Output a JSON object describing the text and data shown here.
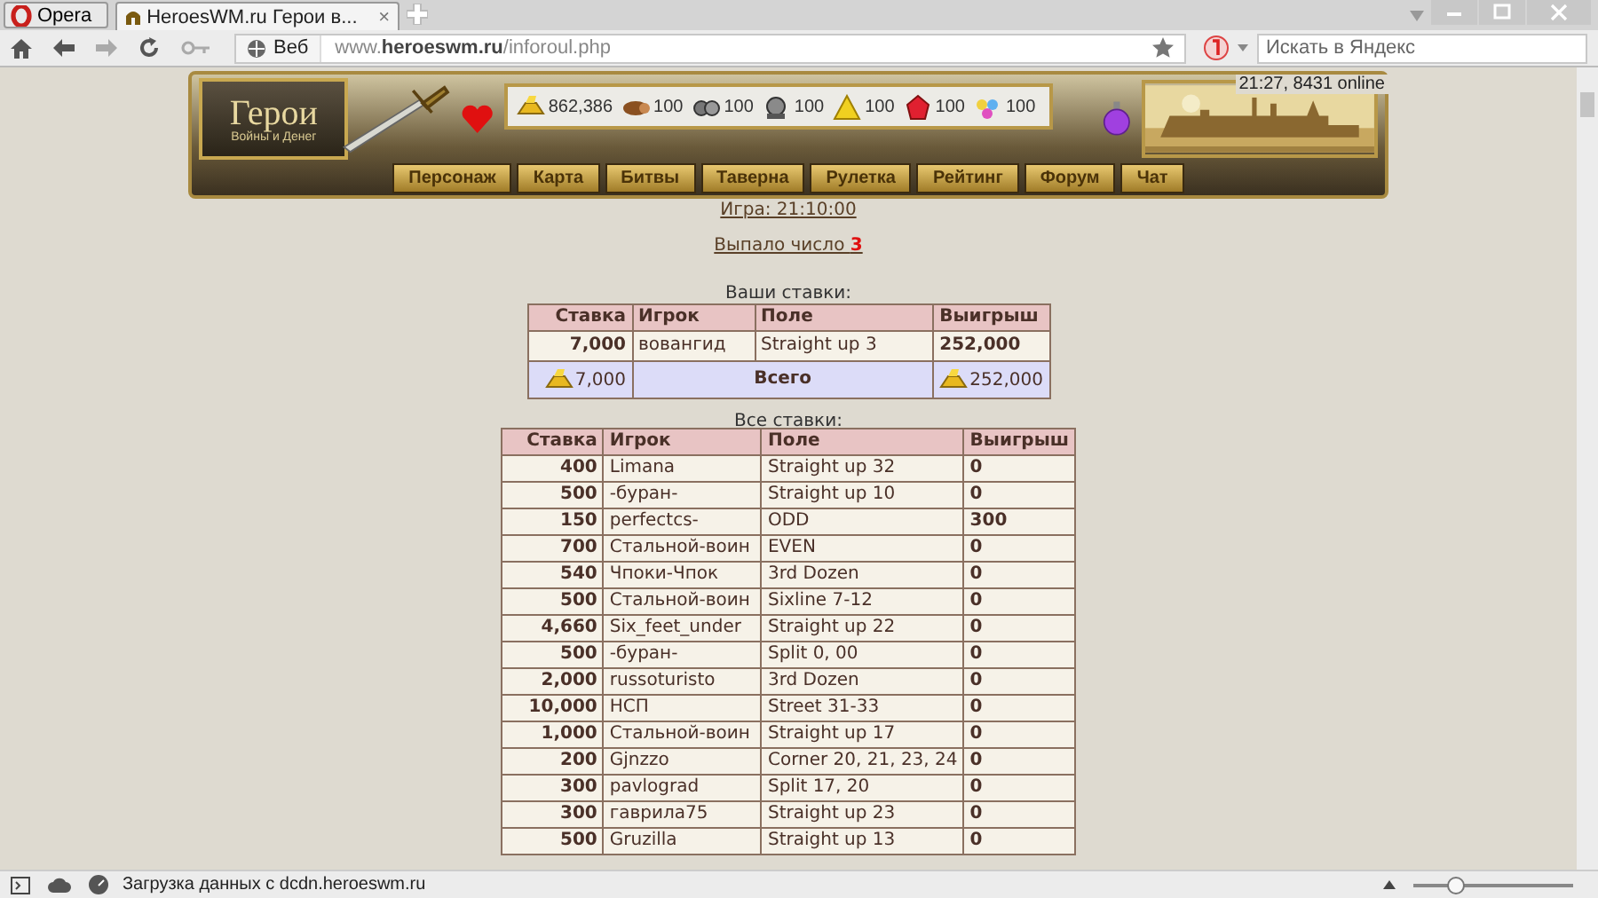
{
  "browser": {
    "menu_button": "Opera",
    "tabs": [
      {
        "title": "HeroesWM.ru Герои в...",
        "selected": true,
        "close": "×"
      }
    ],
    "web_badge": "Веб",
    "address": "www.**heroeswm.ru**/inforoul.php",
    "search": {
      "placeholder": "Искать в Яндекс"
    }
  },
  "header": {
    "logo_title": "Герои",
    "logo_subtitle": "Войны и Денег",
    "clock": "21:27, 8431 online",
    "resources": [
      {
        "kind": "gold",
        "value": "862,386"
      },
      {
        "kind": "wood",
        "value": "100"
      },
      {
        "kind": "ore",
        "value": "100"
      },
      {
        "kind": "mercury",
        "value": "100"
      },
      {
        "kind": "sulfur",
        "value": "100"
      },
      {
        "kind": "crystal",
        "value": "100"
      },
      {
        "kind": "gems",
        "value": "100"
      }
    ],
    "nav": [
      "Персонаж",
      "Карта",
      "Битвы",
      "Таверна",
      "Рулетка",
      "Рейтинг",
      "Форум",
      "Чат"
    ]
  },
  "game": {
    "link": "Игра: 21:10:00",
    "result_label": "Выпало число",
    "result_number": "3"
  },
  "my_bets": {
    "caption": "Ваши ставки:",
    "columns": [
      "Ставка",
      "Игрок",
      "Поле",
      "Выигрыш"
    ],
    "rows": [
      {
        "bet": "7,000",
        "player": "вовангид",
        "field": "Straight up 3",
        "win": "252,000"
      }
    ],
    "total": {
      "bet": "7,000",
      "label": "Всего",
      "win": "252,000"
    }
  },
  "all_bets": {
    "caption": "Все ставки:",
    "columns": [
      "Ставка",
      "Игрок",
      "Поле",
      "Выигрыш"
    ],
    "rows": [
      {
        "bet": "400",
        "player": "Limana",
        "field": "Straight up 32",
        "win": "0"
      },
      {
        "bet": "500",
        "player": "-буран-",
        "field": "Straight up 10",
        "win": "0"
      },
      {
        "bet": "150",
        "player": "perfectcs-",
        "field": "ODD",
        "win": "300"
      },
      {
        "bet": "700",
        "player": "Стальной-воин",
        "field": "EVEN",
        "win": "0"
      },
      {
        "bet": "540",
        "player": "Чпоки-Чпок",
        "field": "3rd Dozen",
        "win": "0"
      },
      {
        "bet": "500",
        "player": "Стальной-воин",
        "field": "Sixline 7-12",
        "win": "0"
      },
      {
        "bet": "4,660",
        "player": "Six_feet_under",
        "field": "Straight up 22",
        "win": "0"
      },
      {
        "bet": "500",
        "player": "-буран-",
        "field": "Split 0, 00",
        "win": "0"
      },
      {
        "bet": "2,000",
        "player": "russoturisto",
        "field": "3rd Dozen",
        "win": "0"
      },
      {
        "bet": "10,000",
        "player": "НСП",
        "field": "Street 31-33",
        "win": "0"
      },
      {
        "bet": "1,000",
        "player": "Стальной-воин",
        "field": "Straight up 17",
        "win": "0"
      },
      {
        "bet": "200",
        "player": "Gjnzzo",
        "field": "Corner 20, 21, 23, 24",
        "win": "0"
      },
      {
        "bet": "300",
        "player": "pavlograd",
        "field": "Split 17, 20",
        "win": "0"
      },
      {
        "bet": "300",
        "player": "гаврила75",
        "field": "Straight up 23",
        "win": "0"
      },
      {
        "bet": "500",
        "player": "Gruzilla",
        "field": "Straight up 13",
        "win": "0"
      }
    ]
  },
  "status_bar": {
    "text": "Загрузка данных с dcdn.heroeswm.ru",
    "zoom": {
      "level": 0.27
    }
  }
}
